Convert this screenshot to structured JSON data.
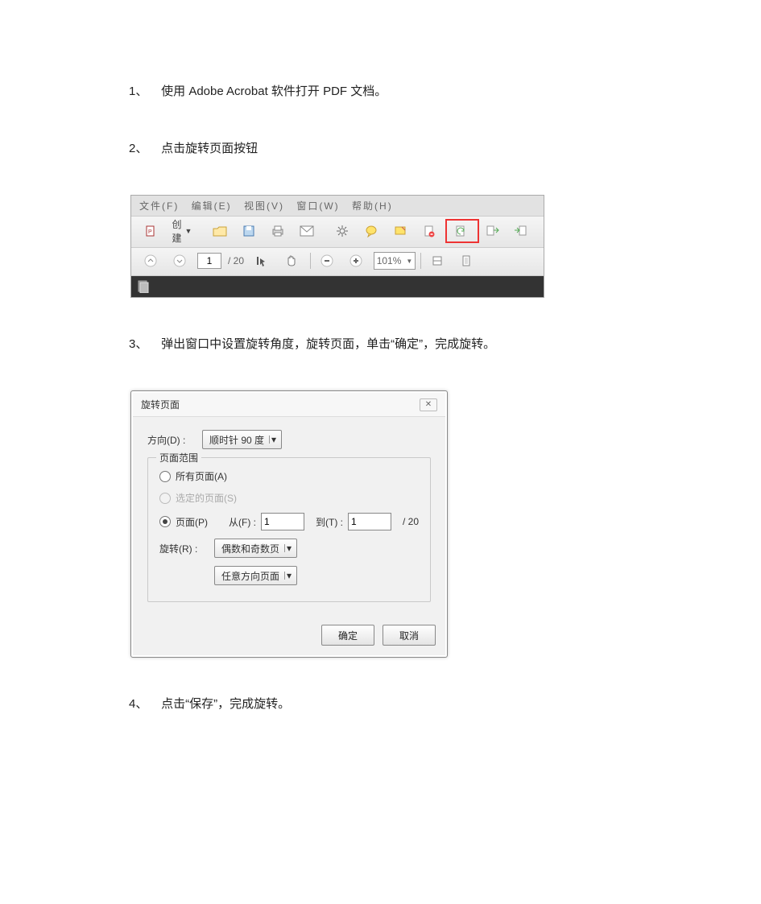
{
  "steps": {
    "s1_num": "1、",
    "s1_text": "使用 Adobe  Acrobat 软件打开 PDF 文档。",
    "s2_num": "2、",
    "s2_text": "点击旋转页面按钮",
    "s3_num": "3、",
    "s3_text": "弹出窗口中设置旋转角度，旋转页面，单击“确定”，完成旋转。",
    "s4_num": "4、",
    "s4_text": "点击“保存”，完成旋转。"
  },
  "toolbar": {
    "menu_file": "文件(F)",
    "menu_edit": "编辑(E)",
    "menu_view": "视图(V)",
    "menu_window": "窗口(W)",
    "menu_help": "帮助(H)",
    "create_label": "创建",
    "page_current": "1",
    "page_total": "/ 20",
    "zoom_display": "101%"
  },
  "dialog": {
    "title": "旋转页面",
    "direction_label": "方向(D) :",
    "direction_value": "顺时针 90 度",
    "range_legend": "页面范围",
    "opt_all": "所有页面(A)",
    "opt_selected": "选定的页面(S)",
    "opt_pages": "页面(P)",
    "from_label": "从(F) :",
    "from_value": "1",
    "to_label": "到(T) :",
    "to_value": "1",
    "of_total": "/ 20",
    "rotate_label": "旋转(R) :",
    "rotate_value1": "偶数和奇数页",
    "rotate_value2": "任意方向页面",
    "ok": "确定",
    "cancel": "取消"
  }
}
